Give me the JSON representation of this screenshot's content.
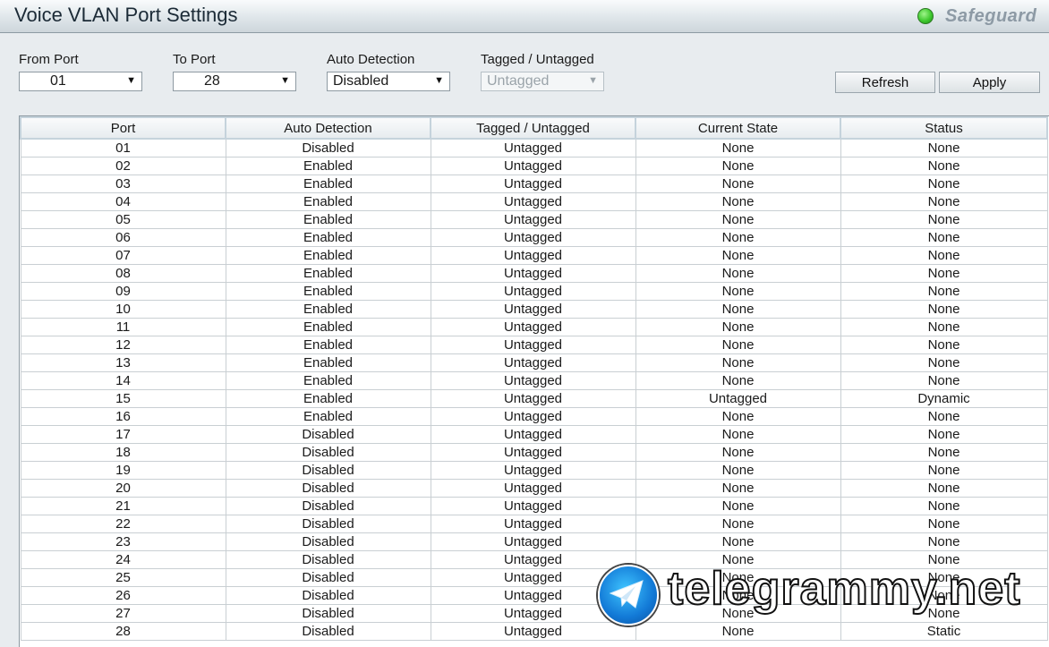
{
  "header": {
    "title": "Voice VLAN Port Settings",
    "brand": "Safeguard",
    "brand_color": "#3fc92f"
  },
  "form": {
    "from_port": {
      "label": "From Port",
      "value": "01"
    },
    "to_port": {
      "label": "To Port",
      "value": "28"
    },
    "auto_detection": {
      "label": "Auto Detection",
      "value": "Disabled"
    },
    "tagged": {
      "label": "Tagged / Untagged",
      "value": "Untagged",
      "disabled": true
    }
  },
  "buttons": {
    "refresh": "Refresh",
    "apply": "Apply"
  },
  "table": {
    "headers": [
      "Port",
      "Auto Detection",
      "Tagged / Untagged",
      "Current State",
      "Status"
    ],
    "rows": [
      [
        "01",
        "Disabled",
        "Untagged",
        "None",
        "None"
      ],
      [
        "02",
        "Enabled",
        "Untagged",
        "None",
        "None"
      ],
      [
        "03",
        "Enabled",
        "Untagged",
        "None",
        "None"
      ],
      [
        "04",
        "Enabled",
        "Untagged",
        "None",
        "None"
      ],
      [
        "05",
        "Enabled",
        "Untagged",
        "None",
        "None"
      ],
      [
        "06",
        "Enabled",
        "Untagged",
        "None",
        "None"
      ],
      [
        "07",
        "Enabled",
        "Untagged",
        "None",
        "None"
      ],
      [
        "08",
        "Enabled",
        "Untagged",
        "None",
        "None"
      ],
      [
        "09",
        "Enabled",
        "Untagged",
        "None",
        "None"
      ],
      [
        "10",
        "Enabled",
        "Untagged",
        "None",
        "None"
      ],
      [
        "11",
        "Enabled",
        "Untagged",
        "None",
        "None"
      ],
      [
        "12",
        "Enabled",
        "Untagged",
        "None",
        "None"
      ],
      [
        "13",
        "Enabled",
        "Untagged",
        "None",
        "None"
      ],
      [
        "14",
        "Enabled",
        "Untagged",
        "None",
        "None"
      ],
      [
        "15",
        "Enabled",
        "Untagged",
        "Untagged",
        "Dynamic"
      ],
      [
        "16",
        "Enabled",
        "Untagged",
        "None",
        "None"
      ],
      [
        "17",
        "Disabled",
        "Untagged",
        "None",
        "None"
      ],
      [
        "18",
        "Disabled",
        "Untagged",
        "None",
        "None"
      ],
      [
        "19",
        "Disabled",
        "Untagged",
        "None",
        "None"
      ],
      [
        "20",
        "Disabled",
        "Untagged",
        "None",
        "None"
      ],
      [
        "21",
        "Disabled",
        "Untagged",
        "None",
        "None"
      ],
      [
        "22",
        "Disabled",
        "Untagged",
        "None",
        "None"
      ],
      [
        "23",
        "Disabled",
        "Untagged",
        "None",
        "None"
      ],
      [
        "24",
        "Disabled",
        "Untagged",
        "None",
        "None"
      ],
      [
        "25",
        "Disabled",
        "Untagged",
        "None",
        "None"
      ],
      [
        "26",
        "Disabled",
        "Untagged",
        "None",
        "None"
      ],
      [
        "27",
        "Disabled",
        "Untagged",
        "None",
        "None"
      ],
      [
        "28",
        "Disabled",
        "Untagged",
        "None",
        "Static"
      ]
    ]
  },
  "watermark": {
    "text": "telegrammy.net",
    "icon": "paper-plane-icon"
  }
}
